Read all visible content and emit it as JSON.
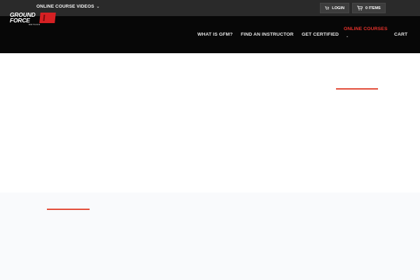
{
  "topbar": {
    "videos_label": "ONLINE COURSE VIDEOS",
    "login_label": "LOGIN",
    "items_label": "0 ITEMS"
  },
  "logo": {
    "line1": "GROUND",
    "line2": "FORCE",
    "line3": "METHOD"
  },
  "nav": {
    "items": [
      {
        "label": "WHAT IS GFM?"
      },
      {
        "label": "FIND AN INSTRUCTOR"
      },
      {
        "label": "GET CERTIFIED"
      },
      {
        "label": "ONLINE COURSES"
      },
      {
        "label": "CART"
      }
    ],
    "active_index": 3
  },
  "colors": {
    "accent": "#e34d3a",
    "active_nav": "#e8322b",
    "topbar_bg": "#2a2a2a",
    "navbar_bg": "#070707",
    "section_bg": "#f9fafc"
  },
  "icons": {
    "videos_dropdown": "chevron-down-icon",
    "login": "cart-icon",
    "items": "cart-icon",
    "online_courses_dropdown": "chevron-down-icon"
  }
}
